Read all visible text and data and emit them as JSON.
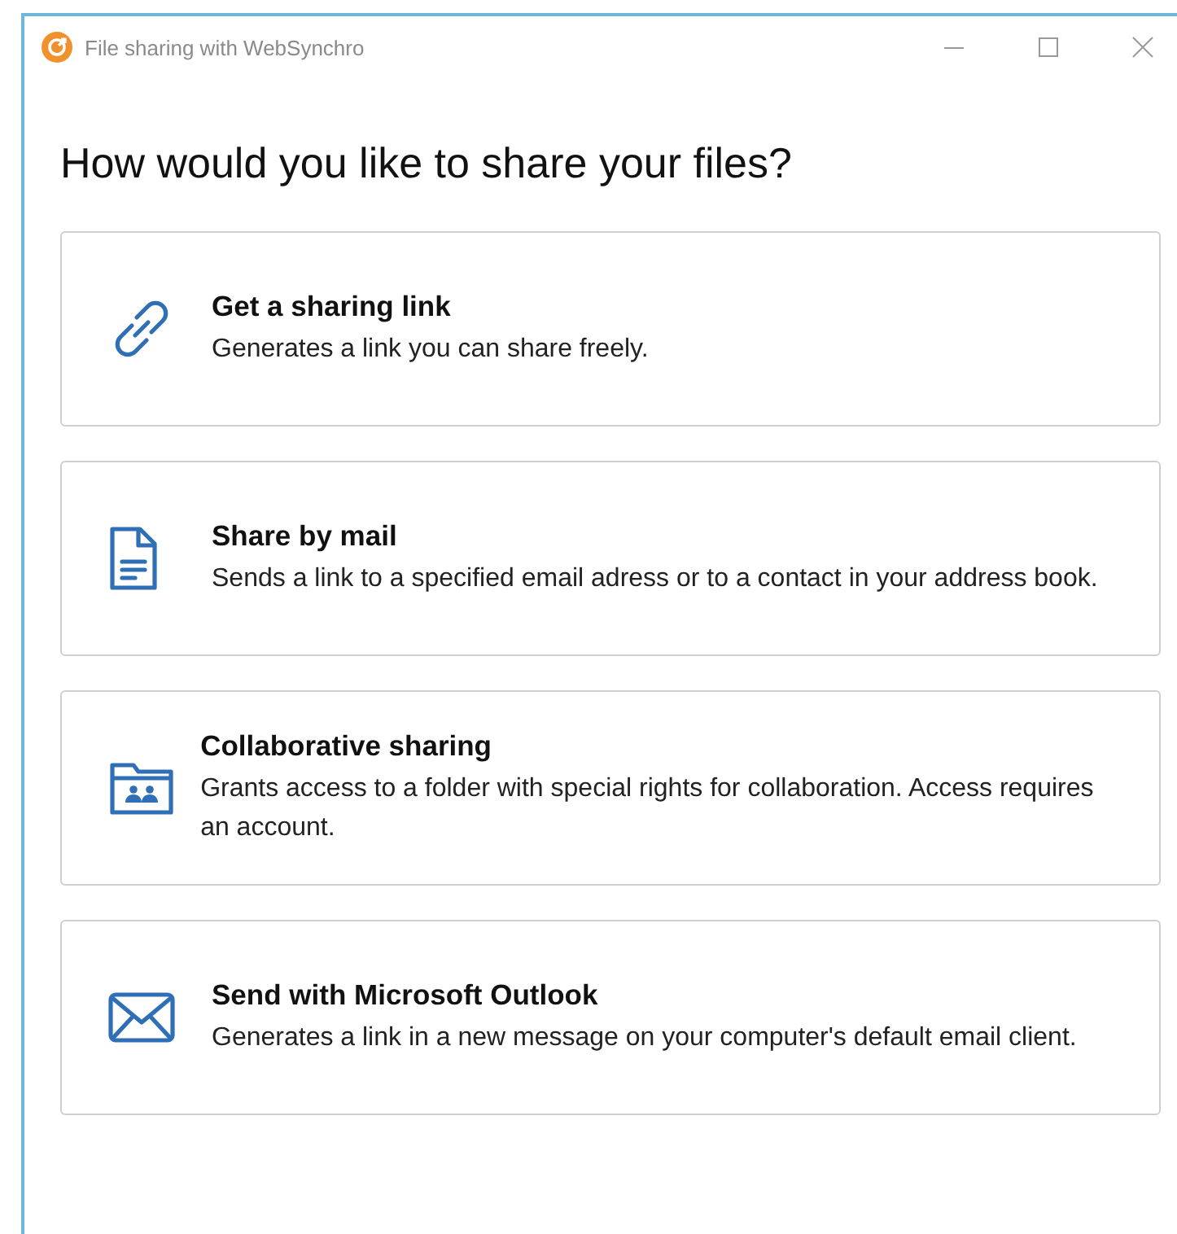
{
  "window": {
    "title": "File sharing with WebSynchro"
  },
  "heading": "How would you like to share your files?",
  "options": [
    {
      "kind": "link",
      "title": "Get a sharing link",
      "description": "Generates a link you can share freely."
    },
    {
      "kind": "document",
      "title": "Share by mail",
      "description": "Sends a link to a specified email adress or to a contact in your address book."
    },
    {
      "kind": "folder",
      "title": "Collaborative sharing",
      "description": "Grants access to a folder with special rights for collaboration. Access requires an account."
    },
    {
      "kind": "envelope",
      "title": "Send with Microsoft Outlook",
      "description": "Generates a link in a new message on your computer's default email client."
    }
  ]
}
